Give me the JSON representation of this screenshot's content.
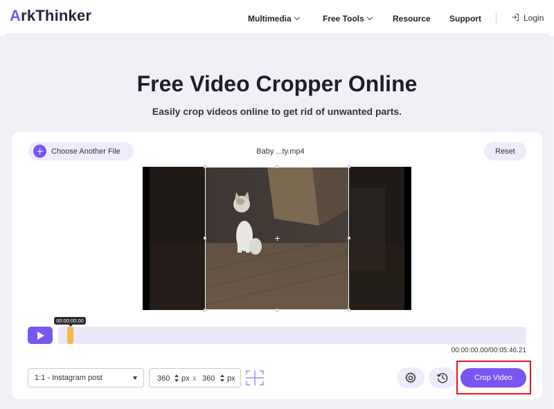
{
  "header": {
    "logo_a": "A",
    "logo_rest": "rkThinker",
    "nav": [
      {
        "label": "Multimedia",
        "has_dropdown": true
      },
      {
        "label": "Free Tools",
        "has_dropdown": true
      },
      {
        "label": "Resource",
        "has_dropdown": false
      },
      {
        "label": "Support",
        "has_dropdown": false
      }
    ],
    "login_label": "Login"
  },
  "hero": {
    "title": "Free Video Cropper Online",
    "subtitle": "Easily crop videos online to get rid of unwanted parts."
  },
  "editor": {
    "choose_file_label": "Choose Another File",
    "file_name": "Baby ...ty.mp4",
    "reset_label": "Reset",
    "current_time": "00:00:00.00",
    "duration": "00:00:00.00/00:05:46.21",
    "aspect_ratio": "1:1 - Instagram post",
    "width_value": "360",
    "height_value": "360",
    "unit": "px",
    "times": "x",
    "crop_button_label": "Crop Video"
  },
  "colors": {
    "accent": "#7a55f2",
    "accent_light": "#efebfa",
    "playhead": "#f7b84a",
    "highlight": "#e8141c"
  },
  "icons": [
    "plus-icon",
    "chevron-down-icon",
    "login-icon",
    "play-icon",
    "crop-center-icon",
    "settings-icon",
    "history-icon"
  ]
}
